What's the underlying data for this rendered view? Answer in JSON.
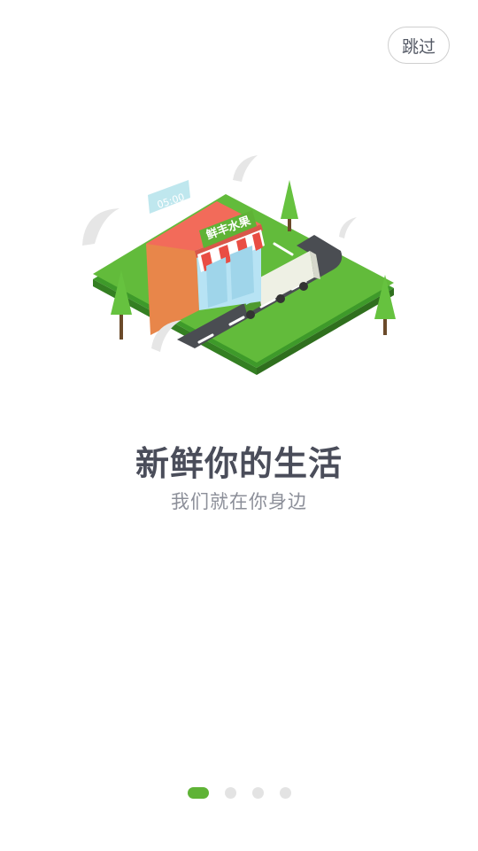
{
  "header": {
    "skip_label": "跳过"
  },
  "illustration": {
    "sign_text": "鲜丰水果",
    "clock_text": "05:00"
  },
  "slide": {
    "title": "新鲜你的生活",
    "subtitle": "我们就在你身边"
  },
  "pager": {
    "total_pages": 4,
    "active_index": 0
  },
  "colors": {
    "accent": "#5fb336",
    "title": "#4a4d5a",
    "subtitle": "#8c8f99",
    "inactive_dot": "#e3e3e3"
  }
}
